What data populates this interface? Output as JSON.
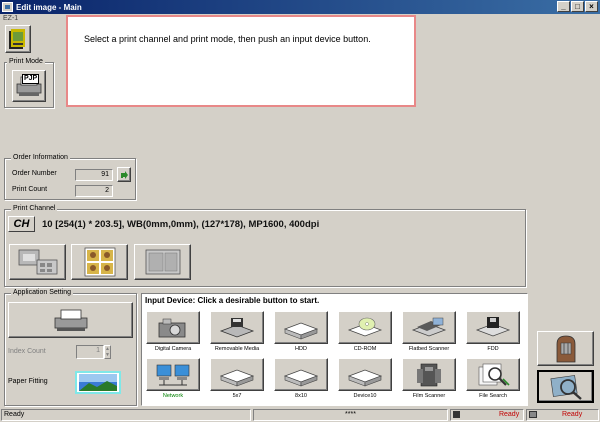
{
  "window": {
    "title": "Edit image - Main",
    "min": "_",
    "max": "□",
    "close": "×"
  },
  "sidebar": {
    "label": "EZ-1",
    "print_mode_label": "Print Mode",
    "print_mode_value": "PJP"
  },
  "message": "Select a print channel and print mode, then push an input device button.",
  "order_info": {
    "label": "Order Information",
    "order_number_label": "Order Number",
    "order_number": "91",
    "print_count_label": "Print Count",
    "print_count": "2"
  },
  "print_channel": {
    "label": "Print Channel",
    "badge": "CH",
    "description": "10 [254(1) * 203.5], WB(0mm,0mm), (127*178), MP1600, 400dpi"
  },
  "app_setting": {
    "label": "Application Setting",
    "index_count_label": "Index Count",
    "index_count": "1",
    "paper_fitting_label": "Paper Fitting"
  },
  "input_device": {
    "header": "Input Device: Click a desirable button to start.",
    "devices": [
      {
        "label": "Digital Camera",
        "icon": "digital-camera-icon"
      },
      {
        "label": "Removable Media",
        "icon": "removable-media-icon"
      },
      {
        "label": "HDD",
        "icon": "hdd-icon"
      },
      {
        "label": "CD-ROM",
        "icon": "cdrom-icon"
      },
      {
        "label": "Flatbed Scanner",
        "icon": "flatbed-scanner-icon"
      },
      {
        "label": "FDD",
        "icon": "fdd-icon"
      },
      {
        "label": "Network",
        "icon": "network-icon"
      },
      {
        "label": "5x7",
        "icon": "drive-icon"
      },
      {
        "label": "8x10",
        "icon": "drive-icon"
      },
      {
        "label": "Device10",
        "icon": "drive-icon"
      },
      {
        "label": "Film Scanner",
        "icon": "film-scanner-icon"
      },
      {
        "label": "File Search",
        "icon": "file-search-icon"
      }
    ]
  },
  "status": {
    "left": "Ready",
    "middle": "****",
    "right1": "Ready",
    "right2": "Ready"
  },
  "colors": {
    "titlebar": "#0a246a",
    "message_border": "#e88888",
    "network_label": "#008000",
    "status_ready": "#c00000"
  }
}
